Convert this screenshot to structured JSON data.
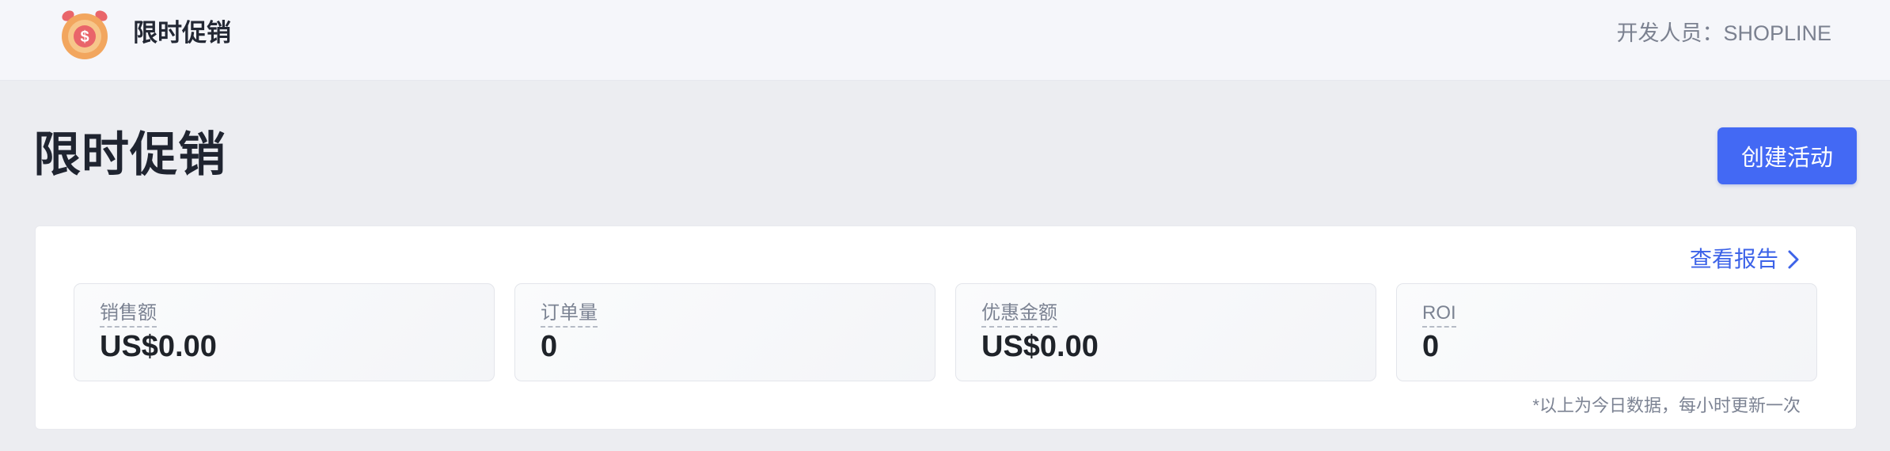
{
  "topbar": {
    "app_name": "限时促销",
    "developer_label": "开发人员：",
    "developer_name": "SHOPLINE"
  },
  "page": {
    "title": "限时促销",
    "create_button": "创建活动"
  },
  "report": {
    "link_label": "查看报告"
  },
  "stats": [
    {
      "label": "销售额",
      "value": "US$0.00"
    },
    {
      "label": "订单量",
      "value": "0"
    },
    {
      "label": "优惠金额",
      "value": "US$0.00"
    },
    {
      "label": "ROI",
      "value": "0"
    }
  ],
  "footnote": "*以上为今日数据，每小时更新一次",
  "colors": {
    "accent": "#4369f4",
    "link": "#3d63e8",
    "background": "#ecedf1"
  },
  "icons": {
    "app": "alarm-clock-dollar-icon",
    "report_arrow": "chevron-right-icon"
  }
}
